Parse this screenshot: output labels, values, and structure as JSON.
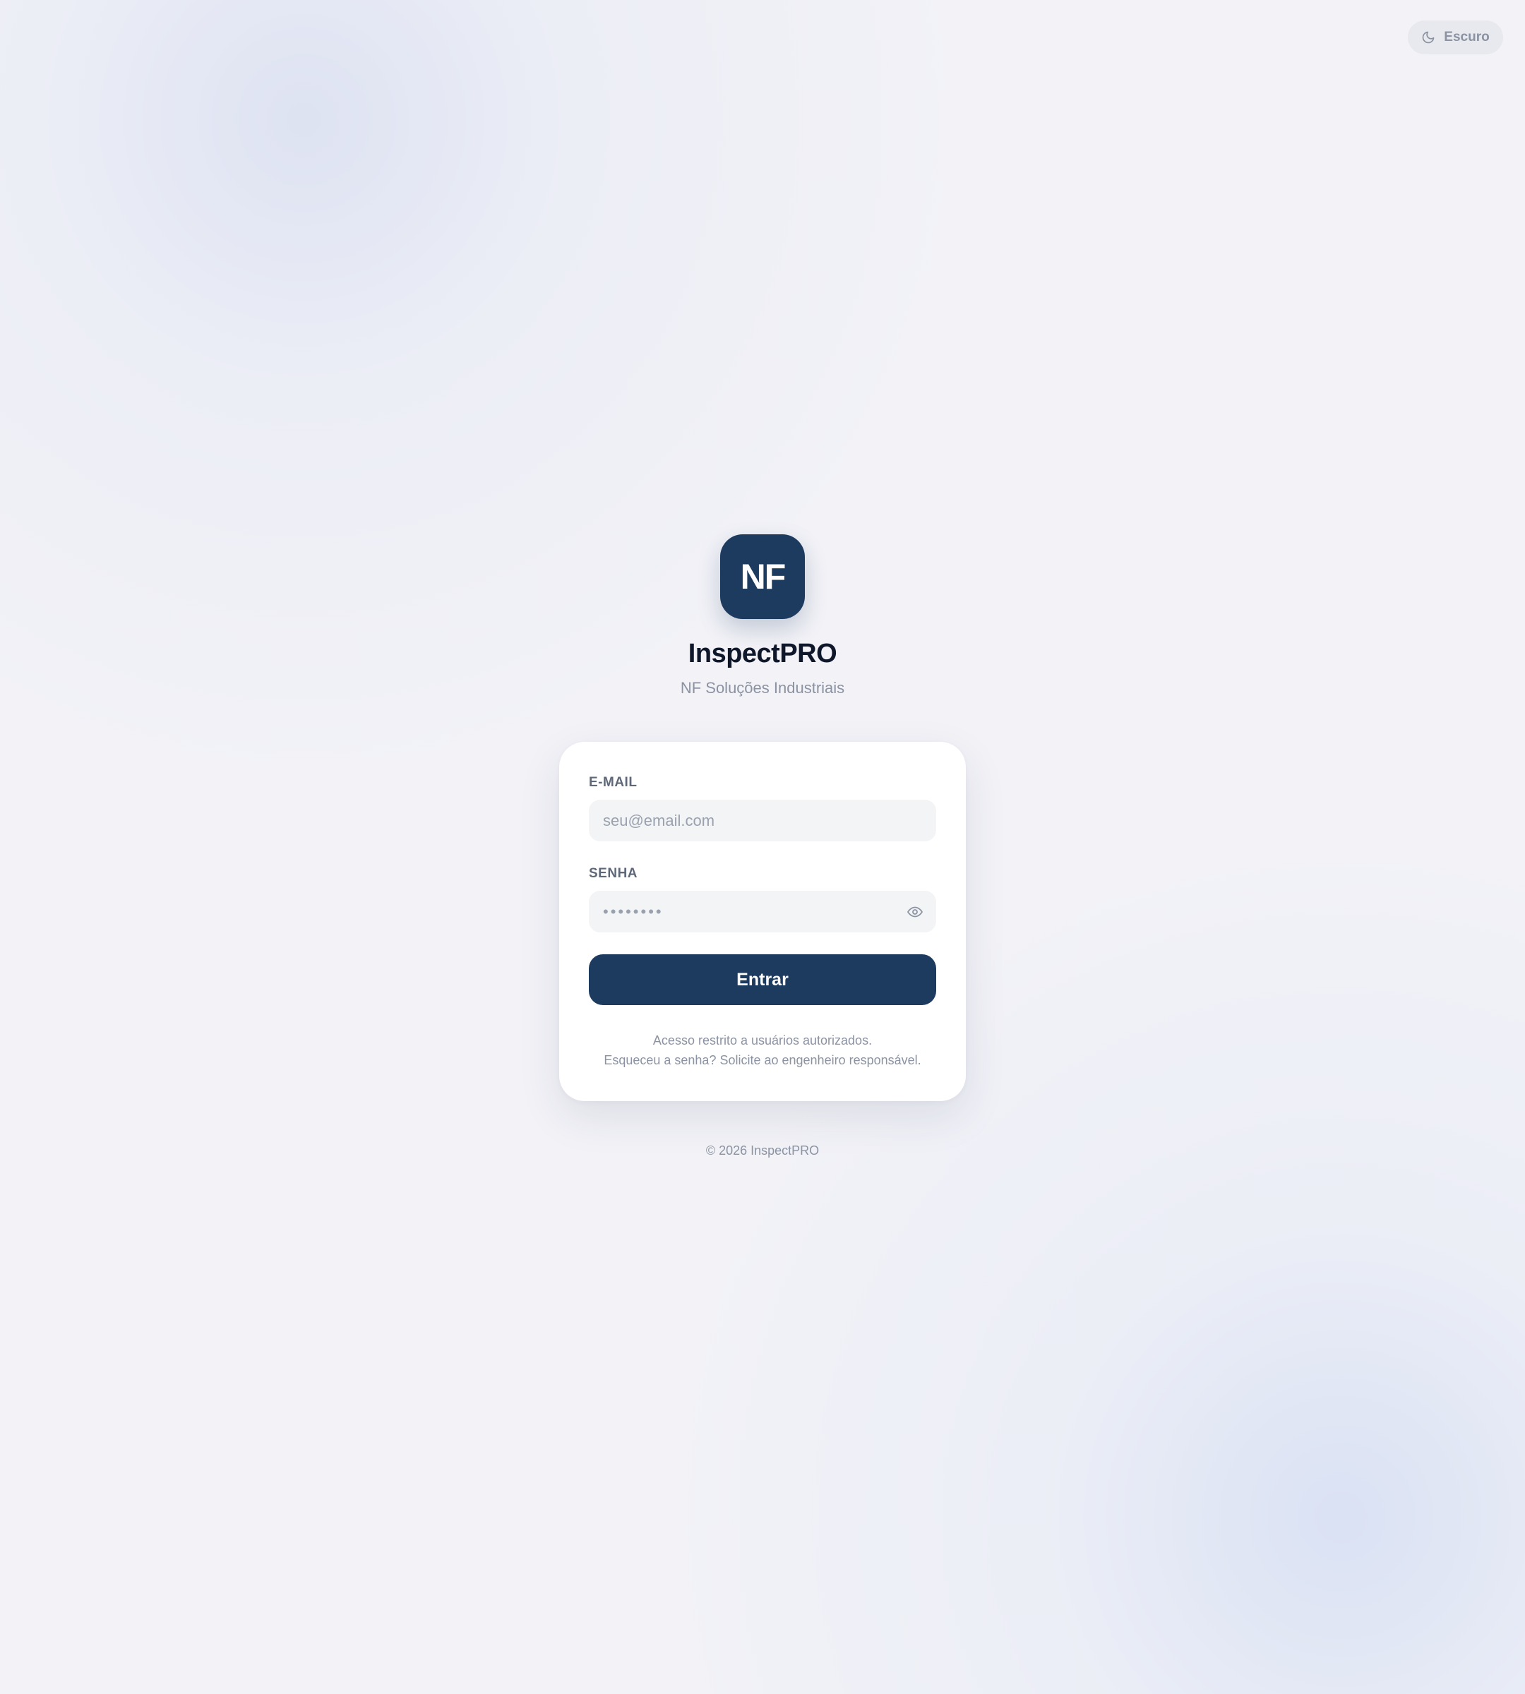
{
  "theme_toggle": {
    "label": "Escuro",
    "icon": "moon-icon"
  },
  "brand": {
    "logo_text": "NF",
    "app_name": "InspectPRO",
    "company": "NF Soluções Industriais"
  },
  "login_form": {
    "email": {
      "label": "E-MAIL",
      "placeholder": "seu@email.com",
      "value": ""
    },
    "password": {
      "label": "SENHA",
      "placeholder": "••••••••",
      "value": "",
      "toggle_icon": "eye-icon"
    },
    "submit_label": "Entrar",
    "notice_line_1": "Acesso restrito a usuários autorizados.",
    "notice_line_2": "Esqueceu a senha? Solicite ao engenheiro responsável."
  },
  "footer": {
    "copyright": "© 2026 InspectPRO"
  },
  "colors": {
    "primary": "#1d3a5f",
    "background": "#f2f2f7",
    "card": "#ffffff",
    "input_background": "#f3f4f6",
    "muted_text": "#8b93a3"
  }
}
